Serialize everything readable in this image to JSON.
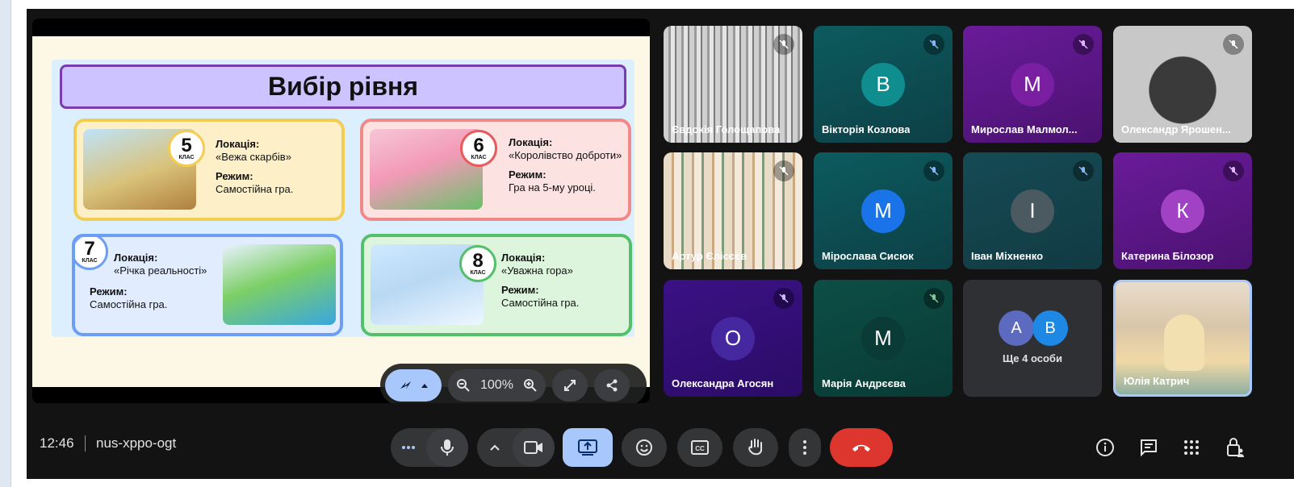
{
  "slide": {
    "title": "Вибір рівня",
    "cards": [
      {
        "grade": "5",
        "grade_word": "КЛАС",
        "location_label": "Локація:",
        "location": "«Вежа скарбів»",
        "mode_label": "Режим:",
        "mode": "Самостійна гра."
      },
      {
        "grade": "6",
        "grade_word": "КЛАС",
        "location_label": "Локація:",
        "location": "«Королівство доброти»",
        "mode_label": "Режим:",
        "mode": "Гра на 5-му уроці."
      },
      {
        "grade": "7",
        "grade_word": "КЛАС",
        "location_label": "Локація:",
        "location": "«Річка реальності»",
        "mode_label": "Режим:",
        "mode": "Самостійна гра."
      },
      {
        "grade": "8",
        "grade_word": "КЛАС",
        "location_label": "Локація:",
        "location": "«Уважна гора»",
        "mode_label": "Режим:",
        "mode": "Самостійна гра."
      }
    ]
  },
  "presentation_toolbar": {
    "zoom": "100%"
  },
  "participants": [
    {
      "name": "Євдокія Голощапова",
      "initial": "",
      "muted": true
    },
    {
      "name": "Вікторія Козлова",
      "initial": "В",
      "muted": true,
      "avatar_color": "#0f8d8f"
    },
    {
      "name": "Мирослав Малмол...",
      "initial": "М",
      "muted": true,
      "avatar_color": "#7b1fa2"
    },
    {
      "name": "Олександр Ярошен...",
      "initial": "",
      "muted": true
    },
    {
      "name": "Артур Єлісєєв",
      "initial": "",
      "muted": true
    },
    {
      "name": "Мірослава Сисюк",
      "initial": "М",
      "muted": true,
      "avatar_color": "#1a73e8"
    },
    {
      "name": "Іван Міхненко",
      "initial": "І",
      "muted": true,
      "avatar_color": "#4a5a60"
    },
    {
      "name": "Катерина Білозор",
      "initial": "К",
      "muted": true,
      "avatar_color": "#a142c4"
    },
    {
      "name": "Олександра Агосян",
      "initial": "О",
      "muted": true,
      "avatar_color": "#4527a0"
    },
    {
      "name": "Марія Андрєєва",
      "initial": "М",
      "muted": true,
      "avatar_color": "#0b3b36"
    },
    {
      "name": "Юлія Катрич",
      "initial": "",
      "muted": false
    }
  ],
  "more_people": {
    "label": "Ще 4 особи",
    "initials": [
      "А",
      "В"
    ],
    "colors": [
      "#5c6bc0",
      "#1e88e5"
    ]
  },
  "bottom_bar": {
    "time": "12:46",
    "meeting_code": "nus-xppo-ogt"
  },
  "colors": {
    "background": "#131314",
    "present_active": "#a8c7fa",
    "end_call": "#dc362e"
  },
  "icons": [
    "more-icon",
    "mic-icon",
    "chevron-up-icon",
    "camera-icon",
    "present-icon",
    "emoji-icon",
    "captions-icon",
    "hand-icon",
    "more-vert-icon",
    "end-call-icon",
    "info-icon",
    "chat-icon",
    "apps-icon",
    "lock-person-icon"
  ]
}
